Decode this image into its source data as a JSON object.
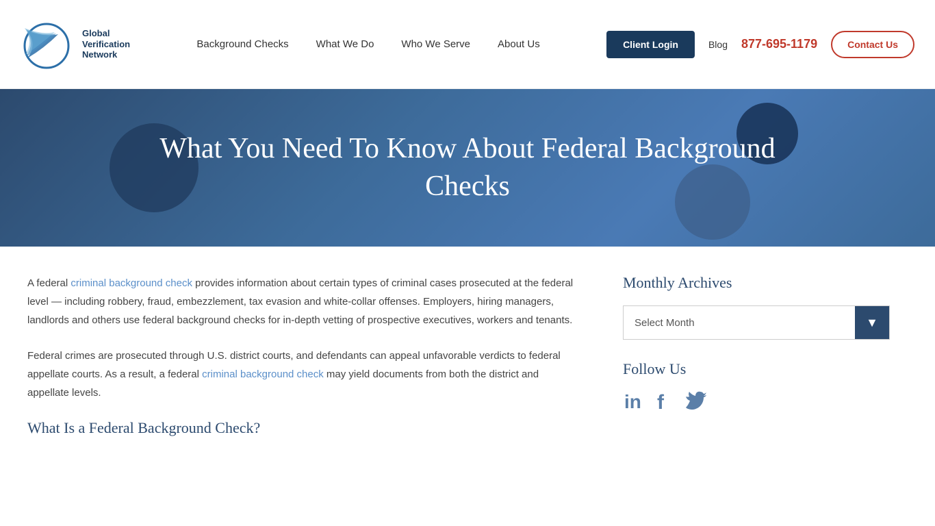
{
  "header": {
    "logo": {
      "line1": "Global",
      "line2": "Verification",
      "line3": "Network"
    },
    "nav": [
      {
        "label": "Background Checks",
        "id": "background-checks"
      },
      {
        "label": "What We Do",
        "id": "what-we-do"
      },
      {
        "label": "Who We Serve",
        "id": "who-we-serve"
      },
      {
        "label": "About Us",
        "id": "about-us"
      }
    ],
    "client_login": "Client Login",
    "blog": "Blog",
    "phone": "877-695-1179",
    "contact_us": "Contact Us"
  },
  "hero": {
    "title": "What You Need To Know About Federal Background Checks"
  },
  "content": {
    "para1_plain": "A federal ",
    "para1_link1": "criminal background check",
    "para1_mid": " provides information about certain types of criminal cases prosecuted at the federal level — including robbery, fraud, embezzlement, tax evasion and white-collar offenses. Employers, hiring managers, landlords and others use federal background checks for in-depth vetting of prospective executives, workers and tenants.",
    "para2_start": "Federal crimes are prosecuted through U.S. district courts, and defendants can appeal unfavorable verdicts to federal appellate courts. As a result, a federal ",
    "para2_link": "criminal background check",
    "para2_end": " may yield documents from both the district and appellate levels.",
    "subtitle": "What Is a Federal Background Check?"
  },
  "sidebar": {
    "archives_title": "Monthly Archives",
    "select_month": "Select Month",
    "follow_us_title": "Follow Us",
    "social": [
      {
        "name": "linkedin",
        "icon": "in"
      },
      {
        "name": "facebook",
        "icon": "f"
      },
      {
        "name": "twitter",
        "icon": "𝕏"
      }
    ]
  },
  "colors": {
    "navy": "#1a3a5c",
    "red": "#c0392b",
    "link_blue": "#5b8fc9"
  }
}
